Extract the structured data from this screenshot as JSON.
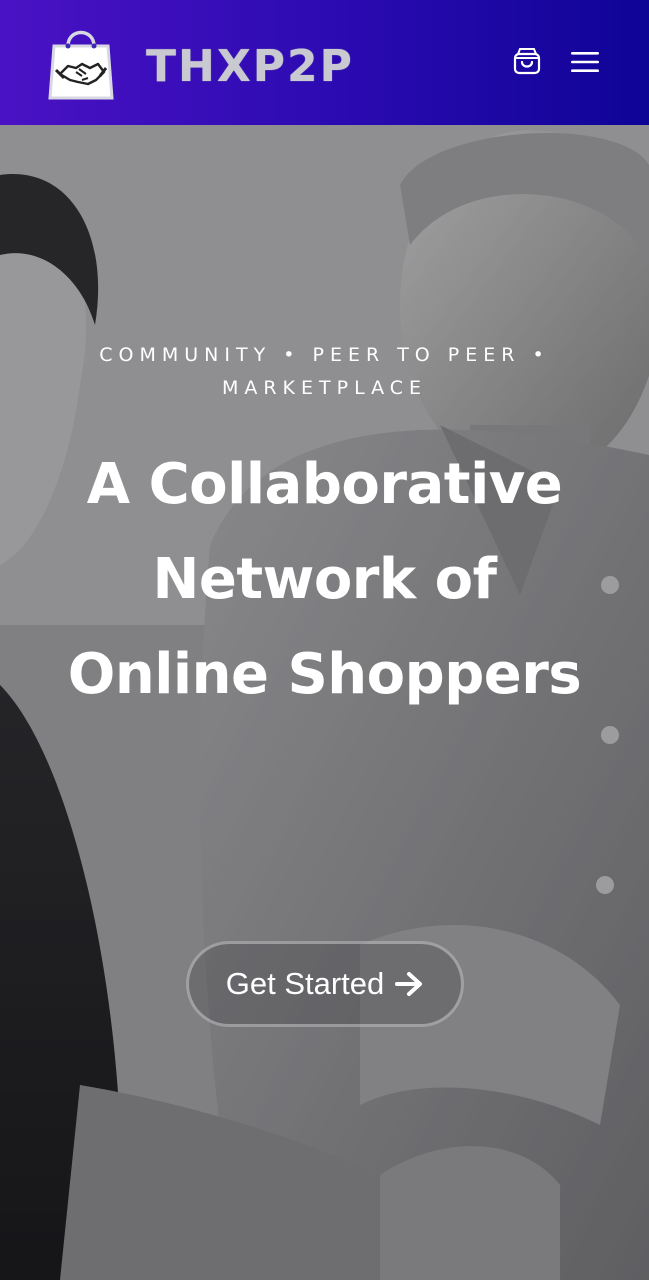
{
  "header": {
    "logo_text": "THXP2P",
    "cart_icon": "shopping-bag-icon",
    "menu_icon": "hamburger-menu-icon",
    "background_gradient": [
      "#4a12c4",
      "#0e0496"
    ]
  },
  "hero": {
    "tagline": "COMMUNITY • PEER TO PEER • MARKETPLACE",
    "headline": "A Collaborative Network of Online Shoppers",
    "cta_label": "Get Started",
    "cta_icon": "arrow-right-icon"
  }
}
